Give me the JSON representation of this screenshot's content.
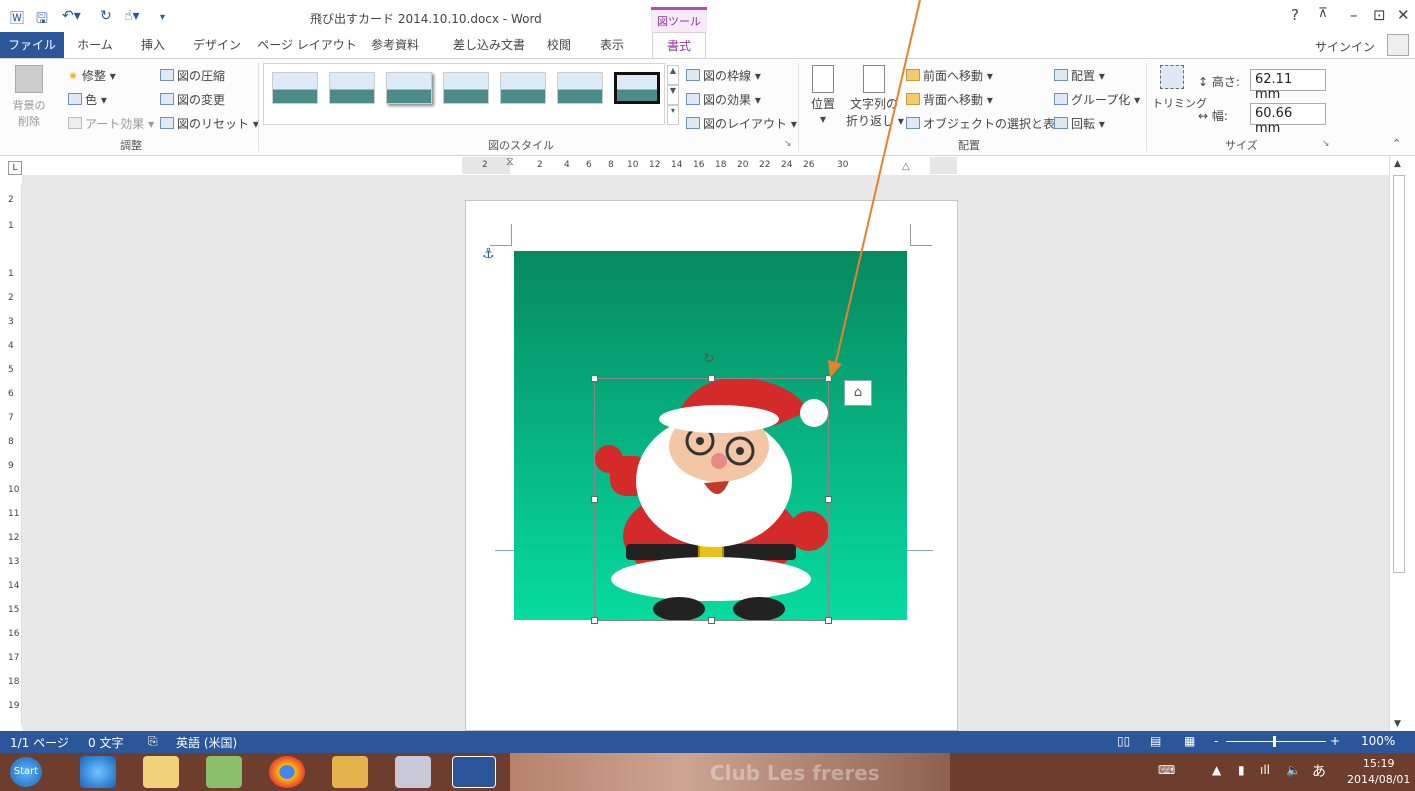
{
  "title_bar": {
    "doc_title": "飛び出すカード 2014.10.10.docx - Word",
    "context_tool": "図ツール",
    "help": "?",
    "minimize": "–",
    "restore": "⊡",
    "close": "✕"
  },
  "tabs": {
    "items": [
      "ファイル",
      "ホーム",
      "挿入",
      "デザイン",
      "ページ レイアウト",
      "参考資料",
      "差し込み文書",
      "校閲",
      "表示",
      "書式"
    ],
    "signin": "サインイン"
  },
  "ribbon": {
    "adjust": {
      "remove_bg": "背景の\n削除",
      "corrections": "修整 ▾",
      "color": "色 ▾",
      "artistic": "アート効果 ▾",
      "compress": "図の圧縮",
      "change": "図の変更",
      "reset": "図のリセット ▾",
      "group_label": "調整"
    },
    "styles": {
      "border": "図の枠線 ▾",
      "effects": "図の効果 ▾",
      "layout": "図のレイアウト ▾",
      "group_label": "図のスタイル"
    },
    "arrange": {
      "position": "位置",
      "wrap": "文字列の\n折り返し ▾",
      "bring_forward": "前面へ移動 ▾",
      "send_backward": "背面へ移動 ▾",
      "selection_pane": "オブジェクトの選択と表示",
      "align": "配置 ▾",
      "group": "グループ化 ▾",
      "rotate": "回転 ▾",
      "group_label": "配置"
    },
    "size": {
      "crop": "トリミング",
      "height_label": "高さ:",
      "height_value": "62.11 mm",
      "width_label": "幅:",
      "width_value": "60.66 mm",
      "group_label": "サイズ"
    }
  },
  "ruler": {
    "h_numbers": [
      "2",
      "2",
      "4",
      "6",
      "8",
      "10",
      "12",
      "14",
      "16",
      "18",
      "20",
      "22",
      "24",
      "26",
      "30"
    ],
    "v_numbers": [
      "2",
      "1",
      "1",
      "2",
      "3",
      "4",
      "5",
      "6",
      "7",
      "8",
      "9",
      "10",
      "11",
      "12",
      "13",
      "14",
      "15",
      "16",
      "17",
      "18",
      "19"
    ]
  },
  "status_bar": {
    "page": "1/1 ページ",
    "words": "0 文字",
    "lang": "英語 (米国)",
    "zoom": "100%",
    "zoom_plus": "+",
    "zoom_minus": "-"
  },
  "taskbar": {
    "start_label": "Start",
    "watermark": "Club Les freres",
    "ime": "あ",
    "time": "15:19",
    "date": "2014/08/01"
  },
  "colors": {
    "word_blue": "#2b579a",
    "context_purple": "#8e3aa1",
    "picture_top": "#07895f",
    "picture_bottom": "#07dba0",
    "arrow": "#e8822a"
  }
}
